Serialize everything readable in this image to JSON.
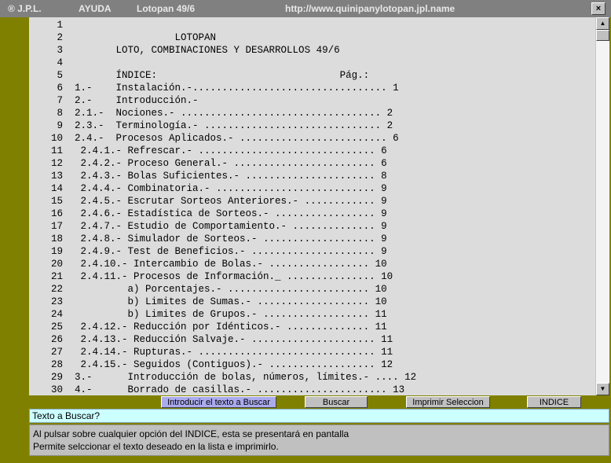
{
  "titlebar": {
    "logo": "® J.P.L.",
    "menu_help": "AYUDA",
    "app_name": "Lotopan 49/6",
    "url": "http://www.quinipanylotopan.jpl.name",
    "close_icon": "close-icon"
  },
  "document": {
    "lines": [
      {
        "n": "1",
        "t": ""
      },
      {
        "n": "2",
        "t": "                 LOTOPAN"
      },
      {
        "n": "3",
        "t": "       LOTO, COMBINACIONES Y DESARROLLOS 49/6"
      },
      {
        "n": "4",
        "t": ""
      },
      {
        "n": "5",
        "t": "       ÍNDICE:                               Pág.:"
      },
      {
        "n": "6",
        "t": "1.-    Instalación.-................................. 1"
      },
      {
        "n": "7",
        "t": "2.-    Introducción.-"
      },
      {
        "n": "8",
        "t": "2.1.-  Nociones.- .................................. 2"
      },
      {
        "n": "9",
        "t": "2.3.-  Terminología.- .............................. 2"
      },
      {
        "n": "10",
        "t": "2.4.-  Procesos Aplicados.- ......................... 6"
      },
      {
        "n": "11",
        "t": " 2.4.1.- Refrescar.- .............................. 6"
      },
      {
        "n": "12",
        "t": " 2.4.2.- Proceso General.- ........................ 6"
      },
      {
        "n": "13",
        "t": " 2.4.3.- Bolas Suficientes.- ...................... 8"
      },
      {
        "n": "14",
        "t": " 2.4.4.- Combinatoria.- ........................... 9"
      },
      {
        "n": "15",
        "t": " 2.4.5.- Escrutar Sorteos Anteriores.- ............ 9"
      },
      {
        "n": "16",
        "t": " 2.4.6.- Estadística de Sorteos.- ................. 9"
      },
      {
        "n": "17",
        "t": " 2.4.7.- Estudio de Comportamiento.- .............. 9"
      },
      {
        "n": "18",
        "t": " 2.4.8.- Simulador de Sorteos.- ................... 9"
      },
      {
        "n": "19",
        "t": " 2.4.9.- Test de Beneficios.- ..................... 9"
      },
      {
        "n": "20",
        "t": " 2.4.10.- Intercambio de Bolas.- ................. 10"
      },
      {
        "n": "21",
        "t": " 2.4.11.- Procesos de Información._ ............... 10"
      },
      {
        "n": "22",
        "t": "         a) Porcentajes.- ........................ 10"
      },
      {
        "n": "23",
        "t": "         b) Limites de Sumas.- ................... 10"
      },
      {
        "n": "24",
        "t": "         b) Limites de Grupos.- .................. 11"
      },
      {
        "n": "25",
        "t": " 2.4.12.- Reducción por Idénticos.- .............. 11"
      },
      {
        "n": "26",
        "t": " 2.4.13.- Reducción Salvaje.- ..................... 11"
      },
      {
        "n": "27",
        "t": " 2.4.14.- Rupturas.- .............................. 11"
      },
      {
        "n": "28",
        "t": " 2.4.15.- Seguidos (Contiguos).- .................. 12"
      },
      {
        "n": "29",
        "t": "3.-      Introducción de bolas, números, límites.- .... 12"
      },
      {
        "n": "30",
        "t": "4.-      Borrado de casillas.- ...................... 13"
      }
    ]
  },
  "scrollbar": {
    "up_icon": "scroll-up-icon",
    "down_icon": "scroll-down-icon"
  },
  "buttons": {
    "introducir": "Introducir el texto a Buscar",
    "buscar": "Buscar",
    "imprimir": "Imprimir Seleccion",
    "indice": "INDICE"
  },
  "search": {
    "placeholder": "Texto a Buscar?"
  },
  "info": {
    "line1": "Al pulsar sobre cualquier opción del INDICE, esta se presentará en pantalla",
    "line2": "Permite selccionar el texto deseado en la lista e imprimirlo."
  },
  "colors": {
    "background": "#808000",
    "titlebar": "#808080",
    "document_bg": "#dcdcdc",
    "search_bg": "#ccffff",
    "introducir_button": "#aaaaee"
  }
}
